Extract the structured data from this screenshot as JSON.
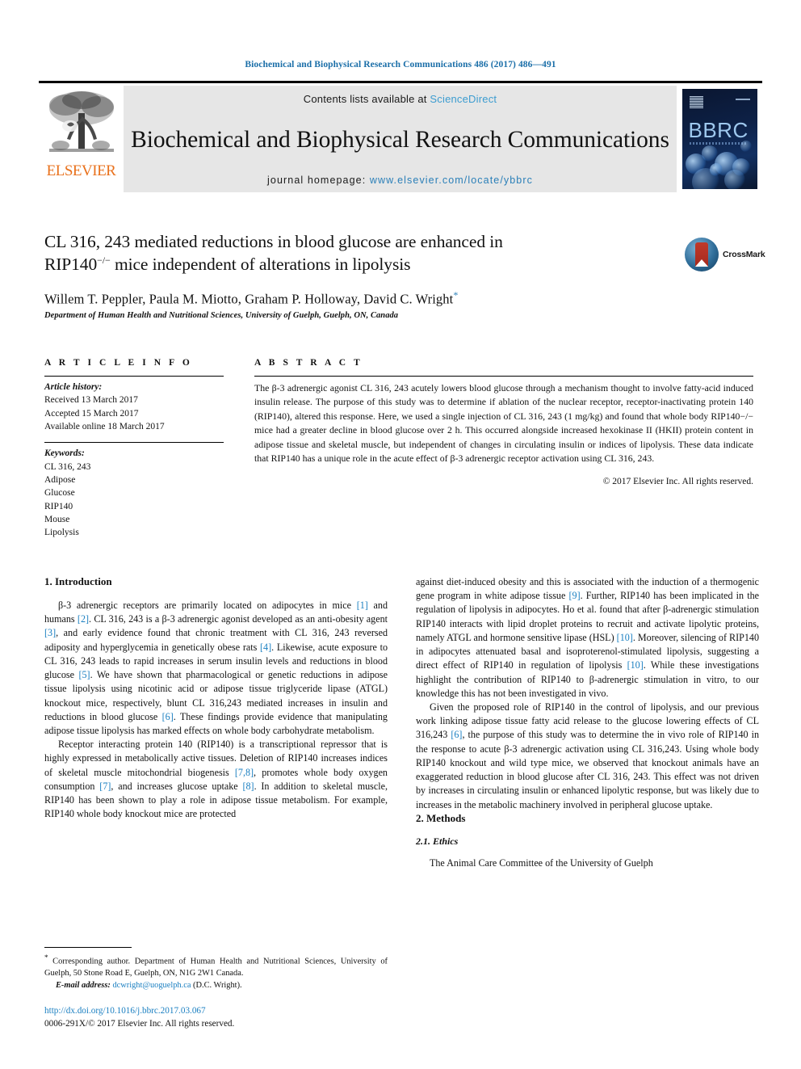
{
  "running_head": "Biochemical and Biophysical Research Communications 486 (2017) 486—491",
  "masthead": {
    "publisher": "ELSEVIER",
    "contents_prefix": "Contents lists available at ",
    "contents_link": "ScienceDirect",
    "journal_title": "Biochemical and Biophysical Research Communications",
    "homepage_prefix": "journal homepage: ",
    "homepage_url": "www.elsevier.com/locate/ybbrc",
    "cover_title": "BBRC"
  },
  "crossmark": {
    "label": "CrossMark"
  },
  "title": {
    "line1": "CL 316, 243 mediated reductions in blood glucose are enhanced in",
    "line2_prefix": "RIP140",
    "line2_sup": "−/−",
    "line2_suffix": " mice independent of alterations in lipolysis"
  },
  "authors": {
    "names": "Willem T. Peppler, Paula M. Miotto, Graham P. Holloway, David C. Wright",
    "corresponding_marker": "*",
    "affiliation": "Department of Human Health and Nutritional Sciences, University of Guelph, Guelph, ON, Canada"
  },
  "article_info": {
    "heading": "A R T I C L E   I N F O",
    "history_label": "Article history:",
    "history": [
      "Received 13 March 2017",
      "Accepted 15 March 2017",
      "Available online 18 March 2017"
    ],
    "keywords_label": "Keywords:",
    "keywords": [
      "CL 316, 243",
      "Adipose",
      "Glucose",
      "RIP140",
      "Mouse",
      "Lipolysis"
    ]
  },
  "abstract": {
    "heading": "A B S T R A C T",
    "text": "The β-3 adrenergic agonist CL 316, 243 acutely lowers blood glucose through a mechanism thought to involve fatty-acid induced insulin release. The purpose of this study was to determine if ablation of the nuclear receptor, receptor-inactivating protein 140 (RIP140), altered this response. Here, we used a single injection of CL 316, 243 (1 mg/kg) and found that whole body RIP140−/− mice had a greater decline in blood glucose over 2 h. This occurred alongside increased hexokinase II (HKII) protein content in adipose tissue and skeletal muscle, but independent of changes in circulating insulin or indices of lipolysis. These data indicate that RIP140 has a unique role in the acute effect of β-3 adrenergic receptor activation using CL 316, 243.",
    "copyright": "© 2017 Elsevier Inc. All rights reserved."
  },
  "sections": {
    "introduction_heading": "1. Introduction",
    "methods_heading": "2. Methods",
    "ethics_heading": "2.1. Ethics"
  },
  "body": {
    "left_p1_a": "β-3 adrenergic receptors are primarily located on adipocytes in mice ",
    "left_p1_r1": "[1]",
    "left_p1_b": " and humans ",
    "left_p1_r2": "[2]",
    "left_p1_c": ". CL 316, 243 is a β-3 adrenergic agonist developed as an anti-obesity agent ",
    "left_p1_r3": "[3]",
    "left_p1_d": ", and early evidence found that chronic treatment with CL 316, 243 reversed adiposity and hyperglycemia in genetically obese rats ",
    "left_p1_r4": "[4]",
    "left_p1_e": ". Likewise, acute exposure to CL 316, 243 leads to rapid increases in serum insulin levels and reductions in blood glucose ",
    "left_p1_r5": "[5]",
    "left_p1_f": ". We have shown that pharmacological or genetic reductions in adipose tissue lipolysis using nicotinic acid or adipose tissue triglyceride lipase (ATGL) knockout mice, respectively, blunt CL 316,243 mediated increases in insulin and reductions in blood glucose ",
    "left_p1_r6": "[6]",
    "left_p1_g": ". These findings provide evidence that manipulating adipose tissue lipolysis has marked effects on whole body carbohydrate metabolism.",
    "left_p2_a": "Receptor interacting protein 140 (RIP140) is a transcriptional repressor that is highly expressed in metabolically active tissues. Deletion of RIP140 increases indices of skeletal muscle mitochondrial biogenesis ",
    "left_p2_r1": "[7,8]",
    "left_p2_b": ", promotes whole body oxygen consumption ",
    "left_p2_r2": "[7]",
    "left_p2_c": ", and increases glucose uptake ",
    "left_p2_r3": "[8]",
    "left_p2_d": ". In addition to skeletal muscle, RIP140 has been shown to play a role in adipose tissue metabolism. For example, RIP140 whole body knockout mice are protected",
    "right_p1_a": "against diet-induced obesity and this is associated with the induction of a thermogenic gene program in white adipose tissue ",
    "right_p1_r1": "[9]",
    "right_p1_b": ". Further, RIP140 has been implicated in the regulation of lipolysis in adipocytes. Ho et al. found that after β-adrenergic stimulation RIP140 interacts with lipid droplet proteins to recruit and activate lipolytic proteins, namely ATGL and hormone sensitive lipase (HSL) ",
    "right_p1_r2": "[10]",
    "right_p1_c": ". Moreover, silencing of RIP140 in adipocytes attenuated basal and isoproterenol-stimulated lipolysis, suggesting a direct effect of RIP140 in regulation of lipolysis ",
    "right_p1_r3": "[10]",
    "right_p1_d": ". While these investigations highlight the contribution of RIP140 to β-adrenergic stimulation in vitro, to our knowledge this has not been investigated in vivo.",
    "right_p2_a": "Given the proposed role of RIP140 in the control of lipolysis, and our previous work linking adipose tissue fatty acid release to the glucose lowering effects of CL 316,243 ",
    "right_p2_r1": "[6]",
    "right_p2_b": ", the purpose of this study was to determine the in vivo role of RIP140 in the response to acute β-3 adrenergic activation using CL 316,243. Using whole body RIP140 knockout and wild type mice, we observed that knockout animals have an exaggerated reduction in blood glucose after CL 316, 243. This effect was not driven by increases in circulating insulin or enhanced lipolytic response, but was likely due to increases in the metabolic machinery involved in peripheral glucose uptake.",
    "right_p3": "The Animal Care Committee of the University of Guelph"
  },
  "footnote": {
    "marker": "*",
    "text": " Corresponding author. Department of Human Health and Nutritional Sciences, University of Guelph, 50 Stone Road E, Guelph, ON, N1G 2W1 Canada.",
    "email_label": "E-mail address:",
    "email": "dcwright@uoguelph.ca",
    "email_suffix": " (D.C. Wright)."
  },
  "doi": {
    "link": "http://dx.doi.org/10.1016/j.bbrc.2017.03.067",
    "issn_line": "0006-291X/© 2017 Elsevier Inc. All rights reserved."
  },
  "colors": {
    "link": "#1a7fc1",
    "running_head": "#1a6ea8",
    "elsevier_orange": "#E9711C",
    "band_bg": "#e6e6e6"
  }
}
